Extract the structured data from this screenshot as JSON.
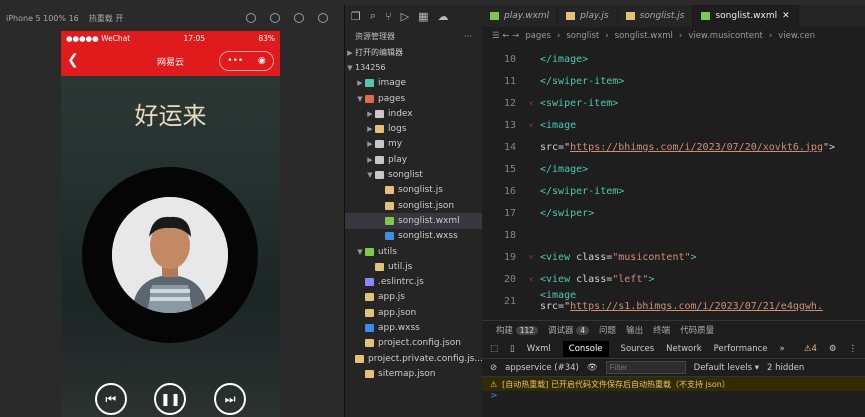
{
  "simulator": {
    "device_label": "iPhone 5 100% 16",
    "hot_reload_label": "热重载 开",
    "status": {
      "carrier": "●●●●● WeChat",
      "time": "17:05",
      "battery": "83%"
    },
    "nav_title": "网易云",
    "song_title": "好运来"
  },
  "explorer": {
    "header": "资源管理器",
    "open_editors": "打开的编辑器",
    "project": "134256",
    "tree": [
      {
        "label": "image",
        "depth": 1,
        "type": "folder",
        "arrow": "▶",
        "color": "#4ec9b0"
      },
      {
        "label": "pages",
        "depth": 1,
        "type": "folder",
        "arrow": "▼",
        "color": "#e06c4a"
      },
      {
        "label": "index",
        "depth": 2,
        "type": "folder",
        "arrow": "▶",
        "color": "#c8c8c8"
      },
      {
        "label": "logs",
        "depth": 2,
        "type": "folder",
        "arrow": "▶",
        "color": "#e5c07b"
      },
      {
        "label": "my",
        "depth": 2,
        "type": "folder",
        "arrow": "▶",
        "color": "#c8c8c8"
      },
      {
        "label": "play",
        "depth": 2,
        "type": "folder",
        "arrow": "▶",
        "color": "#c8c8c8"
      },
      {
        "label": "songlist",
        "depth": 2,
        "type": "folder",
        "arrow": "▼",
        "color": "#c8c8c8"
      },
      {
        "label": "songlist.js",
        "depth": 3,
        "type": "file",
        "arrow": "",
        "color": "#e5c07b"
      },
      {
        "label": "songlist.json",
        "depth": 3,
        "type": "file",
        "arrow": "",
        "color": "#e5c07b"
      },
      {
        "label": "songlist.wxml",
        "depth": 3,
        "type": "file",
        "arrow": "",
        "color": "#7ec850",
        "selected": true
      },
      {
        "label": "songlist.wxss",
        "depth": 3,
        "type": "file",
        "arrow": "",
        "color": "#3c8fe8"
      },
      {
        "label": "utils",
        "depth": 1,
        "type": "folder",
        "arrow": "▼",
        "color": "#7ec850"
      },
      {
        "label": "util.js",
        "depth": 2,
        "type": "file",
        "arrow": "",
        "color": "#e5c07b"
      },
      {
        "label": ".eslintrc.js",
        "depth": 1,
        "type": "file",
        "arrow": "",
        "color": "#8888ff"
      },
      {
        "label": "app.js",
        "depth": 1,
        "type": "file",
        "arrow": "",
        "color": "#e5c07b"
      },
      {
        "label": "app.json",
        "depth": 1,
        "type": "file",
        "arrow": "",
        "color": "#e5c07b"
      },
      {
        "label": "app.wxss",
        "depth": 1,
        "type": "file",
        "arrow": "",
        "color": "#3c8fe8"
      },
      {
        "label": "project.config.json",
        "depth": 1,
        "type": "file",
        "arrow": "",
        "color": "#e5c07b"
      },
      {
        "label": "project.private.config.js...",
        "depth": 1,
        "type": "file",
        "arrow": "",
        "color": "#e5c07b"
      },
      {
        "label": "sitemap.json",
        "depth": 1,
        "type": "file",
        "arrow": "",
        "color": "#e5c07b"
      }
    ]
  },
  "editor": {
    "tabs": [
      {
        "label": "play.wxml",
        "color": "#7ec850",
        "active": false
      },
      {
        "label": "play.js",
        "color": "#e5c07b",
        "active": false
      },
      {
        "label": "songlist.js",
        "color": "#e5c07b",
        "active": false
      },
      {
        "label": "songlist.wxml",
        "color": "#7ec850",
        "active": true
      }
    ],
    "breadcrumb": [
      "pages",
      "songlist",
      "songlist.wxml",
      "view.musicontent",
      "view.cen"
    ],
    "lines": [
      {
        "n": "10",
        "fold": false,
        "parts": [
          {
            "t": "</image>",
            "c": "tag"
          }
        ]
      },
      {
        "n": "11",
        "fold": false,
        "parts": [
          {
            "t": "</swiper-item>",
            "c": "tag"
          }
        ]
      },
      {
        "n": "12",
        "fold": true,
        "parts": [
          {
            "t": "<swiper-item>",
            "c": "tag"
          }
        ]
      },
      {
        "n": "13",
        "fold": true,
        "parts": [
          {
            "t": "<image",
            "c": "tag"
          }
        ]
      },
      {
        "n": "14",
        "fold": false,
        "parts": [
          {
            "t": "src=\"",
            "c": "txt"
          },
          {
            "t": "https://bhimgs.com/i/2023/07/20/xovkt6.jpg",
            "c": "url"
          },
          {
            "t": "\">",
            "c": "txt"
          }
        ]
      },
      {
        "n": "15",
        "fold": false,
        "parts": [
          {
            "t": "</image>",
            "c": "tag"
          }
        ]
      },
      {
        "n": "16",
        "fold": false,
        "parts": [
          {
            "t": "</swiper-item>",
            "c": "tag"
          }
        ]
      },
      {
        "n": "17",
        "fold": false,
        "parts": [
          {
            "t": "</swiper>",
            "c": "tag"
          }
        ]
      },
      {
        "n": "18",
        "fold": false,
        "parts": []
      },
      {
        "n": "19",
        "fold": true,
        "parts": [
          {
            "t": "<view ",
            "c": "tag"
          },
          {
            "t": "class=",
            "c": "txt"
          },
          {
            "t": "\"musicontent\"",
            "c": "str"
          },
          {
            "t": ">",
            "c": "tag"
          }
        ]
      },
      {
        "n": "20",
        "fold": true,
        "parts": [
          {
            "t": "<view ",
            "c": "tag"
          },
          {
            "t": "class=",
            "c": "txt"
          },
          {
            "t": "\"left\"",
            "c": "str"
          },
          {
            "t": ">",
            "c": "tag"
          }
        ]
      },
      {
        "n": "21",
        "fold": false,
        "parts": [
          {
            "t": "<image ",
            "c": "tag"
          },
          {
            "t": "src=\"",
            "c": "txt"
          },
          {
            "t": "https://s1.bhimgs.com/i/2023/07/21/e4qgwh.",
            "c": "url"
          }
        ]
      }
    ]
  },
  "panel": {
    "tabs": [
      {
        "label": "构建",
        "badge": "112"
      },
      {
        "label": "调试器",
        "badge": "4"
      },
      {
        "label": "问题",
        "badge": ""
      },
      {
        "label": "输出",
        "badge": ""
      },
      {
        "label": "终端",
        "badge": ""
      },
      {
        "label": "代码质量",
        "badge": ""
      }
    ],
    "devtools_tabs": [
      "Wxml",
      "Console",
      "Sources",
      "Network",
      "Performance",
      "»"
    ],
    "warnings": "4",
    "context": "appservice (#34)",
    "filter_placeholder": "Filter",
    "levels": "Default levels ▾",
    "hidden": "2 hidden",
    "message": "[自动热重载] 已开启代码文件保存后自动热重载（不支持 json）",
    "prompt": ">"
  }
}
